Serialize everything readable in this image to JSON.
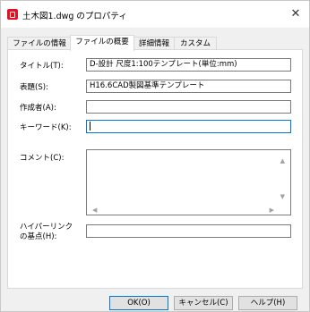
{
  "window": {
    "title": "土木図1.dwg のプロパティ",
    "close_glyph": "✕"
  },
  "tabs": [
    {
      "label": "ファイルの情報"
    },
    {
      "label": "ファイルの概要"
    },
    {
      "label": "詳細情報"
    },
    {
      "label": "カスタム"
    }
  ],
  "fields": {
    "title": {
      "label": "タイトル(T):",
      "value": "D-設計  尺度1:100テンプレート(単位:mm)"
    },
    "subject": {
      "label": "表題(S):",
      "value": "H16.6CAD製図基準テンプレート"
    },
    "author": {
      "label": "作成者(A):",
      "value": ""
    },
    "keywords": {
      "label": "キーワード(K):",
      "value": ""
    },
    "comments": {
      "label": "コメント(C):",
      "value": ""
    },
    "hyperlink_base": {
      "label_line1": "ハイパーリンク",
      "label_line2": "の基点(H):",
      "value": ""
    }
  },
  "buttons": {
    "ok": "OK(O)",
    "cancel": "キャンセル(C)",
    "help": "ヘルプ(H)"
  },
  "icons": {
    "app": "autocad-icon",
    "close": "close-icon",
    "scroll_up": "▲",
    "scroll_down": "▼",
    "scroll_left": "◀",
    "scroll_right": "▶"
  }
}
